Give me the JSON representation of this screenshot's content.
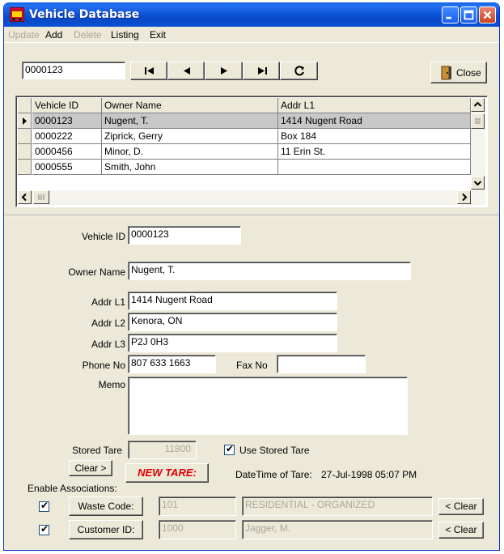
{
  "window": {
    "title": "Vehicle Database"
  },
  "menu": {
    "update": "Update",
    "add": "Add",
    "delete": "Delete",
    "listing": "Listing",
    "exit": "Exit"
  },
  "toolbar": {
    "search_value": "0000123",
    "close_label": "Close"
  },
  "grid": {
    "columns": [
      "Vehicle ID",
      "Owner Name",
      "Addr L1"
    ],
    "rows": [
      [
        "0000123",
        "Nugent, T.",
        "1414 Nugent Road"
      ],
      [
        "0000222",
        "Ziprick, Gerry",
        "Box 184"
      ],
      [
        "0000456",
        "Minor, D.",
        "11 Erin St."
      ],
      [
        "0000555",
        "Smith, John",
        ""
      ]
    ]
  },
  "form": {
    "vehicle_id_label": "Vehicle ID",
    "vehicle_id": "0000123",
    "owner_name_label": "Owner Name",
    "owner_name": "Nugent, T.",
    "addr1_label": "Addr L1",
    "addr1": "1414 Nugent Road",
    "addr2_label": "Addr L2",
    "addr2": "Kenora, ON",
    "addr3_label": "Addr L3",
    "addr3": "P2J 0H3",
    "phone_label": "Phone No",
    "phone": "807 633 1663",
    "fax_label": "Fax No",
    "fax": "",
    "memo_label": "Memo",
    "memo": "",
    "stored_tare_label": "Stored Tare",
    "stored_tare": "11800",
    "use_stored_tare_label": "Use Stored Tare",
    "clear_label": "Clear >",
    "new_tare_label": "NEW TARE:",
    "datetime_label": "DateTime of Tare:",
    "datetime_value": "27-Jul-1998 05:07 PM",
    "enable_assoc_label": "Enable Associations:",
    "waste_code_button": "Waste Code:",
    "waste_code": "101",
    "waste_desc": "RESIDENTIAL - ORGANIZED",
    "customer_id_button": "Customer ID:",
    "customer_id": "1000",
    "customer_name": "Jagger, M.",
    "clear_assoc_label": "< Clear"
  },
  "colors": {
    "title_bar": "#0b51d1",
    "window_bg": "#ece9d8",
    "new_tare": "#e00000"
  },
  "icons": [
    "first-record-icon",
    "prev-record-icon",
    "next-record-icon",
    "last-record-icon",
    "refresh-icon",
    "close-door-icon"
  ]
}
